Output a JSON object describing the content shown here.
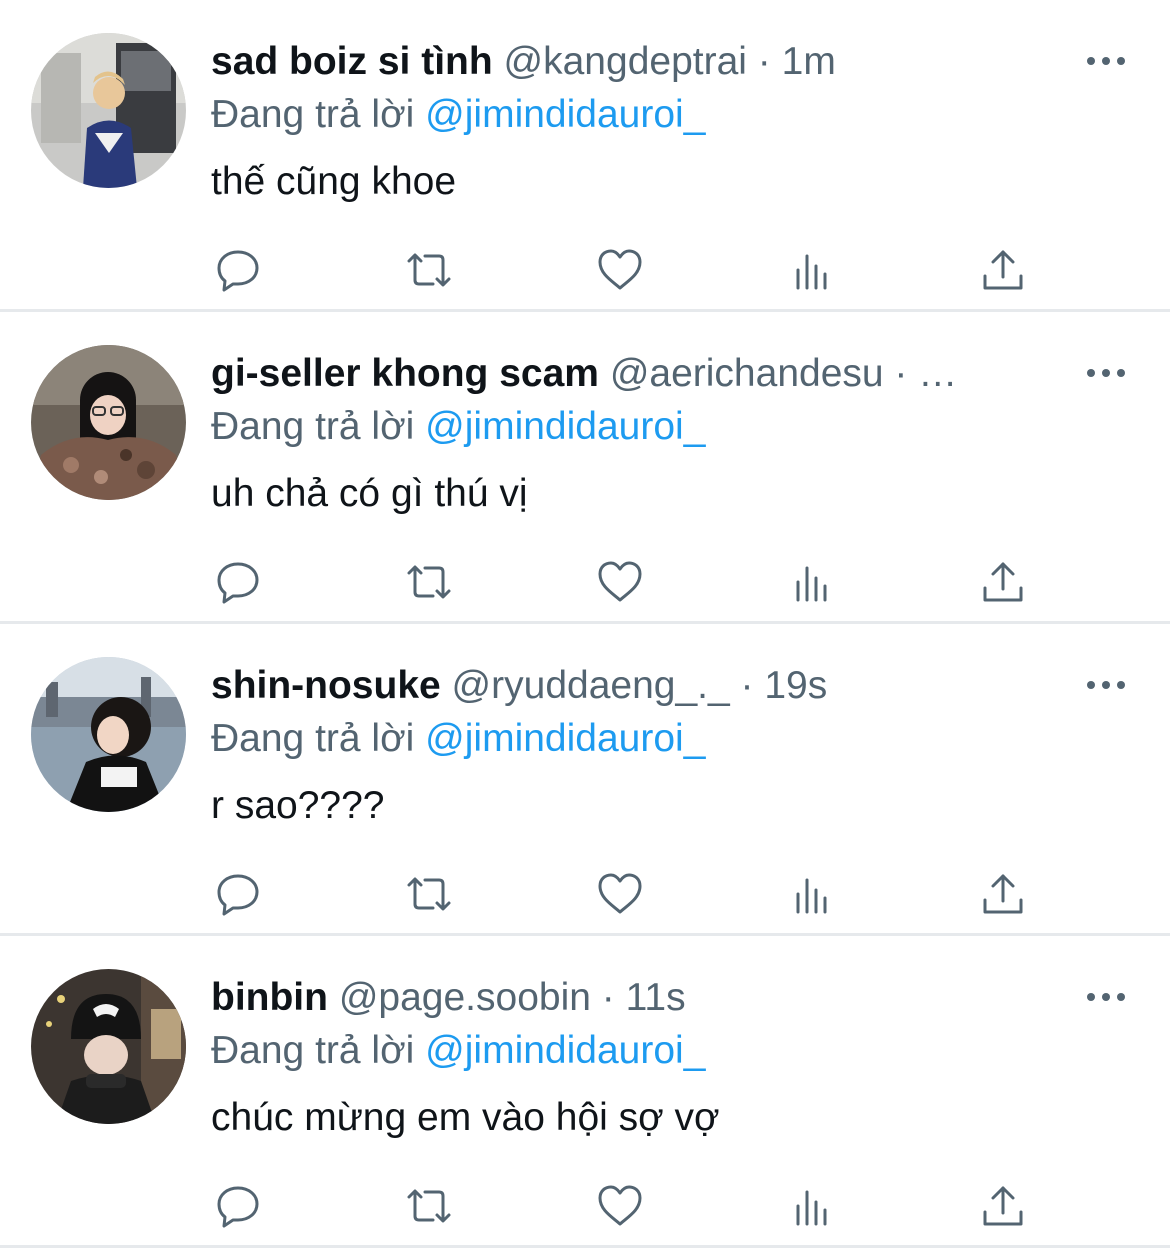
{
  "colors": {
    "text": "#0f1419",
    "secondary": "#536471",
    "link": "#1d9bf0",
    "divider": "#e6e9ec"
  },
  "actions": {
    "reply_icon": "reply-bubble-icon",
    "retweet_icon": "retweet-icon",
    "like_icon": "heart-icon",
    "views_icon": "views-bar-chart-icon",
    "share_icon": "share-upload-icon"
  },
  "tweets": [
    {
      "display_name": "sad boiz si tình",
      "handle": "@kangdeptrai",
      "separator": " · ",
      "time": "1m",
      "reply_prefix": "Đang trả lời ",
      "reply_to": "@jimindidauroi_",
      "text": "thế cũng khoe"
    },
    {
      "display_name": "gi-seller khong scam",
      "handle": "@aerichandesu",
      "separator": " · ",
      "time": "…",
      "reply_prefix": "Đang trả lời ",
      "reply_to": "@jimindidauroi_",
      "text": "uh chả có gì thú vị"
    },
    {
      "display_name": "shin-nosuke",
      "handle": "@ryuddaeng_._",
      "separator": " · ",
      "time": "19s",
      "reply_prefix": "Đang trả lời ",
      "reply_to": "@jimindidauroi_",
      "text": "r sao????"
    },
    {
      "display_name": "binbin",
      "handle": "@page.soobin",
      "separator": " · ",
      "time": "11s",
      "reply_prefix": "Đang trả lời ",
      "reply_to": "@jimindidauroi_",
      "text": "chúc mừng em vào hội sợ vợ"
    }
  ]
}
